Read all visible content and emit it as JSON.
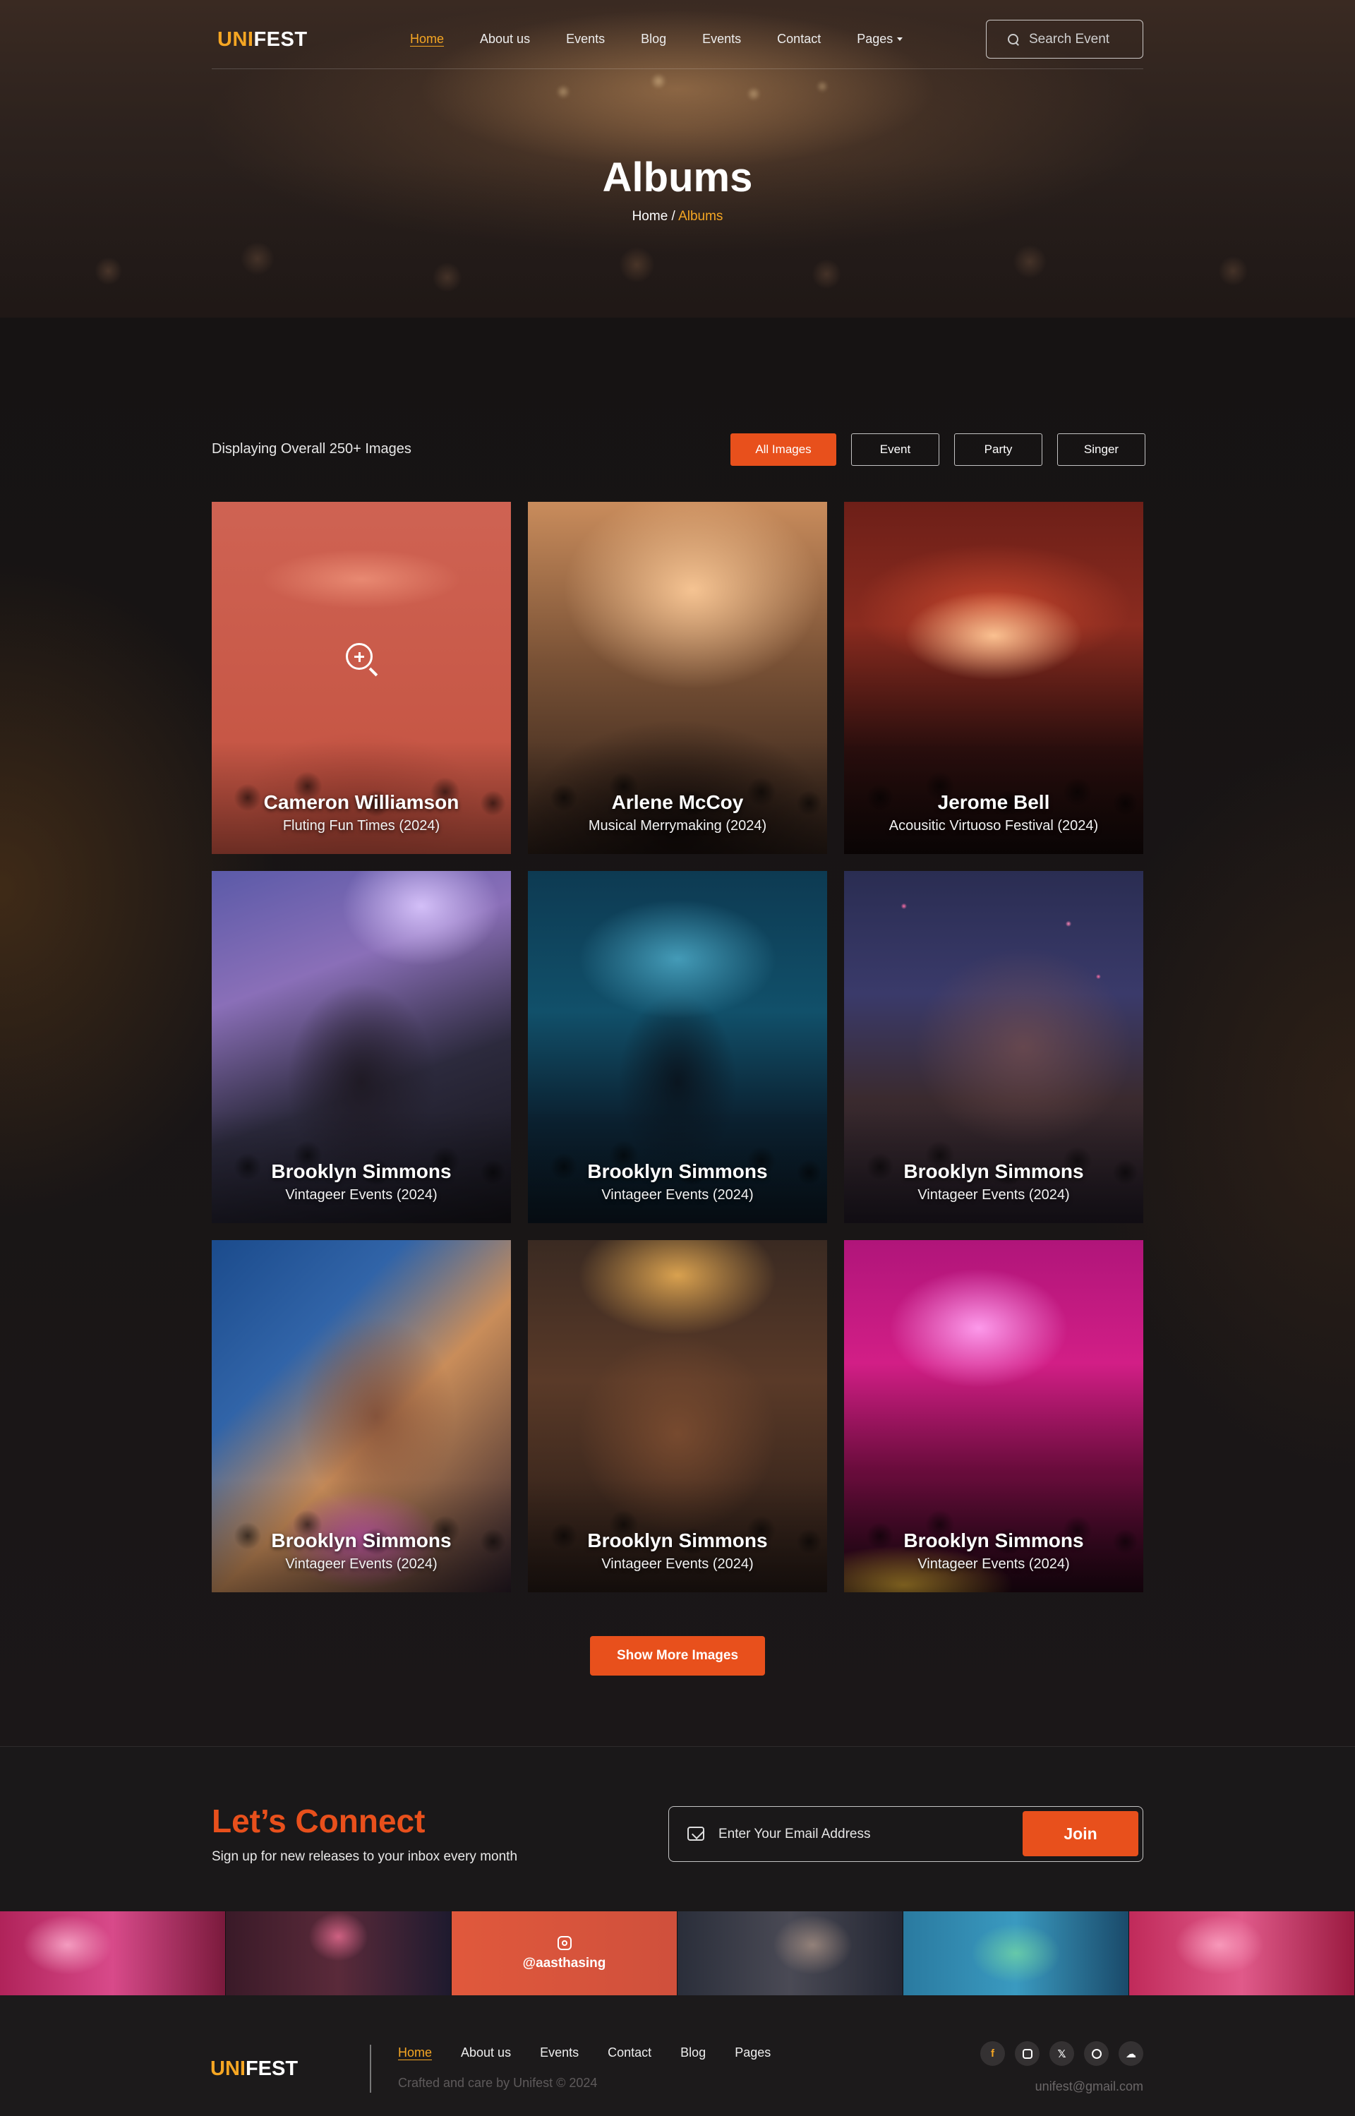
{
  "brand": {
    "logo_part1": "UNI",
    "logo_part2": "FEST"
  },
  "nav": {
    "items": [
      {
        "label": "Home",
        "active": true
      },
      {
        "label": "About us"
      },
      {
        "label": "Events"
      },
      {
        "label": "Blog"
      },
      {
        "label": "Events"
      },
      {
        "label": "Contact"
      },
      {
        "label": "Pages",
        "has_dropdown": true
      }
    ],
    "search_placeholder": "Search Event"
  },
  "hero": {
    "title": "Albums",
    "breadcrumb_home": "Home",
    "breadcrumb_separator": " / ",
    "breadcrumb_current": "Albums"
  },
  "gallery": {
    "display_text": "Displaying Overall 250+ Images",
    "filters": [
      {
        "label": "All Images",
        "active": true
      },
      {
        "label": "Event"
      },
      {
        "label": "Party"
      },
      {
        "label": "Singer"
      }
    ],
    "cards": [
      {
        "name": "Cameron Williamson",
        "subtitle": "Fluting Fun Times (2024)",
        "hovered": true
      },
      {
        "name": "Arlene McCoy",
        "subtitle": "Musical Merrymaking (2024)"
      },
      {
        "name": "Jerome Bell",
        "subtitle": "Acousitic Virtuoso Festival (2024)"
      },
      {
        "name": "Brooklyn Simmons",
        "subtitle": "Vintageer Events (2024)"
      },
      {
        "name": "Brooklyn Simmons",
        "subtitle": "Vintageer Events (2024)"
      },
      {
        "name": "Brooklyn Simmons",
        "subtitle": "Vintageer Events (2024)"
      },
      {
        "name": "Brooklyn Simmons",
        "subtitle": "Vintageer Events (2024)"
      },
      {
        "name": "Brooklyn Simmons",
        "subtitle": "Vintageer Events (2024)"
      },
      {
        "name": "Brooklyn Simmons",
        "subtitle": "Vintageer Events (2024)"
      }
    ],
    "show_more_label": "Show More Images"
  },
  "newsletter": {
    "title": "Let’s Connect",
    "subtitle": "Sign up for new releases to your inbox every month",
    "email_placeholder": "Enter Your Email Address",
    "join_label": "Join"
  },
  "instagram": {
    "handle": "@aasthasing"
  },
  "footer": {
    "links": [
      {
        "label": "Home",
        "active": true
      },
      {
        "label": "About us"
      },
      {
        "label": "Events"
      },
      {
        "label": "Contact"
      },
      {
        "label": "Blog"
      },
      {
        "label": "Pages"
      }
    ],
    "copyright": "Crafted and care by Unifest © 2024",
    "email": "unifest@gmail.com",
    "socials": [
      "facebook-icon",
      "instagram-icon",
      "x-icon",
      "spotify-icon",
      "soundcloud-icon"
    ]
  },
  "colors": {
    "accent_orange": "#e8501c",
    "brand_yellow": "#f5a623",
    "background": "#161313"
  }
}
